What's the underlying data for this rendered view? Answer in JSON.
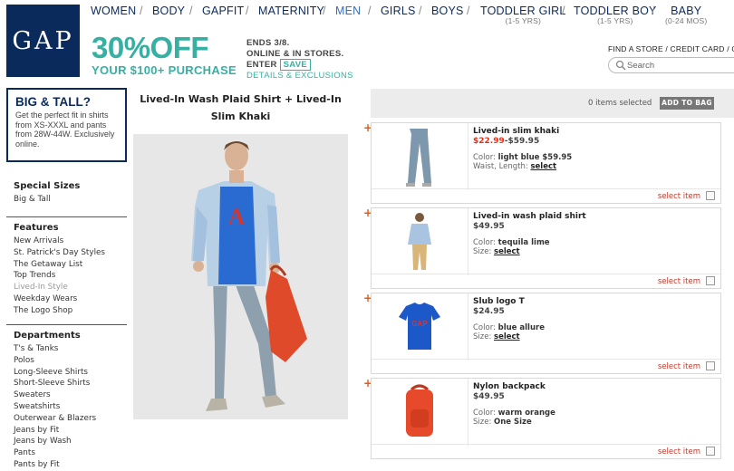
{
  "brand": {
    "logo": "GAP"
  },
  "nav": {
    "items": [
      {
        "label": "WOMEN",
        "sub": ""
      },
      {
        "label": "BODY",
        "sub": ""
      },
      {
        "label": "GAPFIT",
        "sub": ""
      },
      {
        "label": "MATERNITY",
        "sub": ""
      },
      {
        "label": "MEN",
        "sub": "",
        "selected": true
      },
      {
        "label": "GIRLS",
        "sub": ""
      },
      {
        "label": "BOYS",
        "sub": ""
      },
      {
        "label": "TODDLER GIRL",
        "sub": "(1-5 YRS)"
      },
      {
        "label": "TODDLER BOY",
        "sub": "(1-5 YRS)"
      },
      {
        "label": "BABY",
        "sub": "(0-24 MOS)"
      }
    ],
    "separator": "/"
  },
  "promo": {
    "headline": "30%OFF",
    "subline": "YOUR $100+ PURCHASE",
    "ends": "ENDS 3/8.",
    "where": "ONLINE & IN STORES.",
    "enter": "ENTER",
    "code": "SAVE",
    "details": "DETAILS & EXCLUSIONS"
  },
  "utility": {
    "find_store": "FIND A STORE",
    "credit_card": "CREDIT CARD",
    "sep": "/",
    "trailing": "G"
  },
  "search": {
    "placeholder": "Search"
  },
  "left_promo": {
    "title": "BIG & TALL?",
    "desc": "Get the perfect fit in shirts from XS-XXXL and pants from 28W-44W. Exclusively online."
  },
  "sidebar": {
    "special": {
      "heading": "Special Sizes",
      "items": [
        "Big & Tall"
      ]
    },
    "features": {
      "heading": "Features",
      "items": [
        "New Arrivals",
        "St. Patrick's Day Styles",
        "The Getaway List",
        "Top Trends",
        "Lived-In Style",
        "Weekday Wears",
        "The Logo Shop"
      ],
      "active_index": 4
    },
    "departments": {
      "heading": "Departments",
      "items": [
        "T's & Tanks",
        "Polos",
        "Long-Sleeve Shirts",
        "Short-Sleeve Shirts",
        "Sweaters",
        "Sweatshirts",
        "Outerwear & Blazers",
        "Jeans by Fit",
        "Jeans by Wash",
        "Pants",
        "Pants by Fit"
      ]
    }
  },
  "product": {
    "title": "Lived-In Wash Plaid Shirt + Lived-In Slim Khaki"
  },
  "bag": {
    "items_selected": "0 items selected",
    "add_label": "ADD TO BAG"
  },
  "items": [
    {
      "name": "Lived-in slim khaki",
      "sale": "$22.99",
      "price": "-$59.95",
      "color_label": "Color:",
      "color": "light blue $59.95",
      "size_label": "Waist, Length:",
      "size": "select",
      "size_is_link": true,
      "select_label": "select item",
      "thumb": "pants-icon",
      "accent": "#7d97ac"
    },
    {
      "name": "Lived-in wash plaid shirt",
      "sale": "",
      "price": "$49.95",
      "color_label": "Color:",
      "color": "tequila lime",
      "size_label": "Size:",
      "size": "select",
      "size_is_link": true,
      "select_label": "select item",
      "thumb": "person-icon",
      "accent": "#a9c4e0"
    },
    {
      "name": "Slub logo T",
      "sale": "",
      "price": "$24.95",
      "color_label": "Color:",
      "color": "blue allure",
      "size_label": "Size:",
      "size": "select",
      "size_is_link": true,
      "select_label": "select item",
      "thumb": "tshirt-icon",
      "accent": "#1d58c8"
    },
    {
      "name": "Nylon backpack",
      "sale": "",
      "price": "$49.95",
      "color_label": "Color:",
      "color": "warm orange",
      "size_label": "Size:",
      "size": "One Size",
      "size_is_link": false,
      "select_label": "select item",
      "thumb": "backpack-icon",
      "accent": "#e64a2b"
    }
  ],
  "colors": {
    "navy": "#0b2a5c",
    "teal": "#36b0a3",
    "sale_red": "#e3301a",
    "orange": "#e35a1a"
  }
}
